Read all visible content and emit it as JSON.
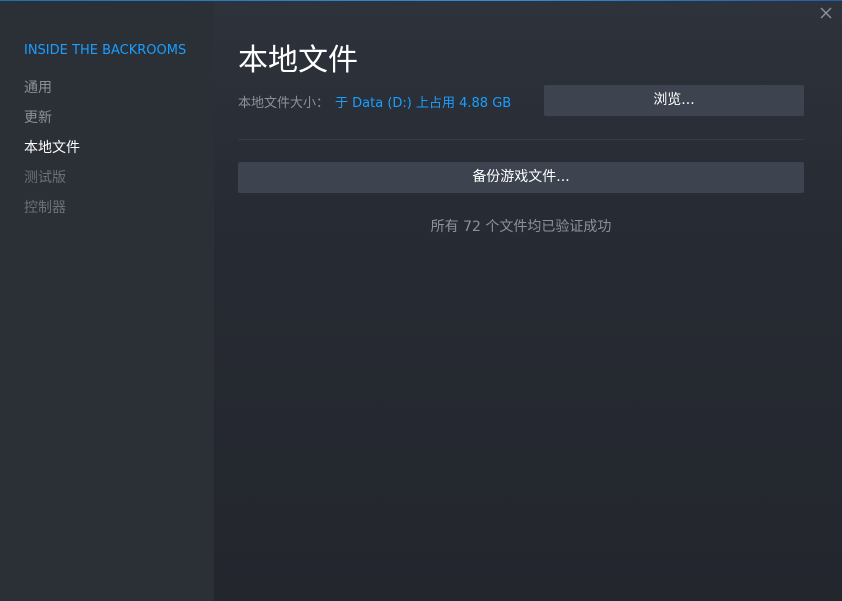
{
  "sidebar": {
    "game_title": "INSIDE THE BACKROOMS",
    "items": [
      {
        "label": "通用"
      },
      {
        "label": "更新"
      },
      {
        "label": "本地文件"
      },
      {
        "label": "测试版"
      },
      {
        "label": "控制器"
      }
    ],
    "active_item": "本地文件"
  },
  "main": {
    "title": "本地文件",
    "size_label": "本地文件大小：",
    "size_value": "于 Data (D:) 上占用 4.88 GB",
    "browse_label": "浏览...",
    "backup_label": "备份游戏文件...",
    "status_text": "所有 72 个文件均已验证成功"
  },
  "icons": {
    "close": "close-icon"
  },
  "colors": {
    "accent": "#1a9fff",
    "sidebar_bg": "#2b2f36",
    "main_bg": "#262a32",
    "button_bg": "#3d4450"
  }
}
